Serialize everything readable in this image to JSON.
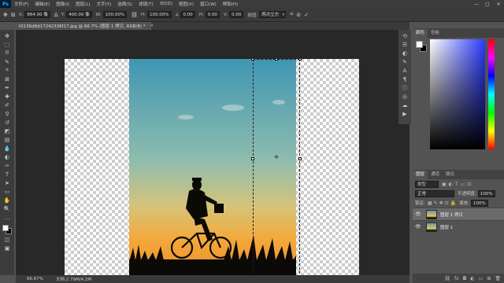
{
  "menu": {
    "logo": "Ps",
    "items": [
      "文件(F)",
      "编辑(E)",
      "图像(I)",
      "图层(L)",
      "文字(Y)",
      "选择(S)",
      "滤镜(T)",
      "3D(D)",
      "视图(V)",
      "窗口(W)",
      "帮助(H)"
    ],
    "window_controls": [
      "—",
      "□",
      "✕"
    ]
  },
  "options": {
    "x_label": "X:",
    "x_value": "864.00 像",
    "y_label": "Y:",
    "y_value": "400.00 像",
    "w_label": "W:",
    "w_value": "100.00%",
    "h_label": "H:",
    "h_value": "100.00%",
    "angle_value": "0.00",
    "hskew_label": "H:",
    "hskew_value": "0.00",
    "vskew_label": "V:",
    "vskew_value": "0.00",
    "interp_label": "插值:",
    "interp_value": "两次立方"
  },
  "document": {
    "tab_title": "t0136d6d17242336f17.jpg @ 66.7% (图层 1 拷贝, RGB/8) *",
    "close_glyph": "×"
  },
  "status": {
    "zoom": "66.67%",
    "doc_info": "文档:2.79M/4.2M"
  },
  "color_panel": {
    "tabs": [
      "颜色",
      "色板"
    ],
    "fg": "#ffffff",
    "bg": "#000000"
  },
  "layers_panel": {
    "tabs": [
      "图层",
      "通道",
      "路径"
    ],
    "kind_filter": "类型",
    "blend_mode": "正常",
    "opacity_label": "不透明度:",
    "opacity_value": "100%",
    "lock_label": "锁定:",
    "fill_label": "填充:",
    "fill_value": "100%",
    "layers": [
      {
        "name": "图层 1 拷贝",
        "selected": true
      },
      {
        "name": "图层 1",
        "selected": false
      }
    ]
  },
  "colors": {
    "sky_top": "#3f96b3",
    "sky_mid": "#a9c88f",
    "sky_bottom": "#f4a83a",
    "silhouette": "#0c0a07"
  }
}
